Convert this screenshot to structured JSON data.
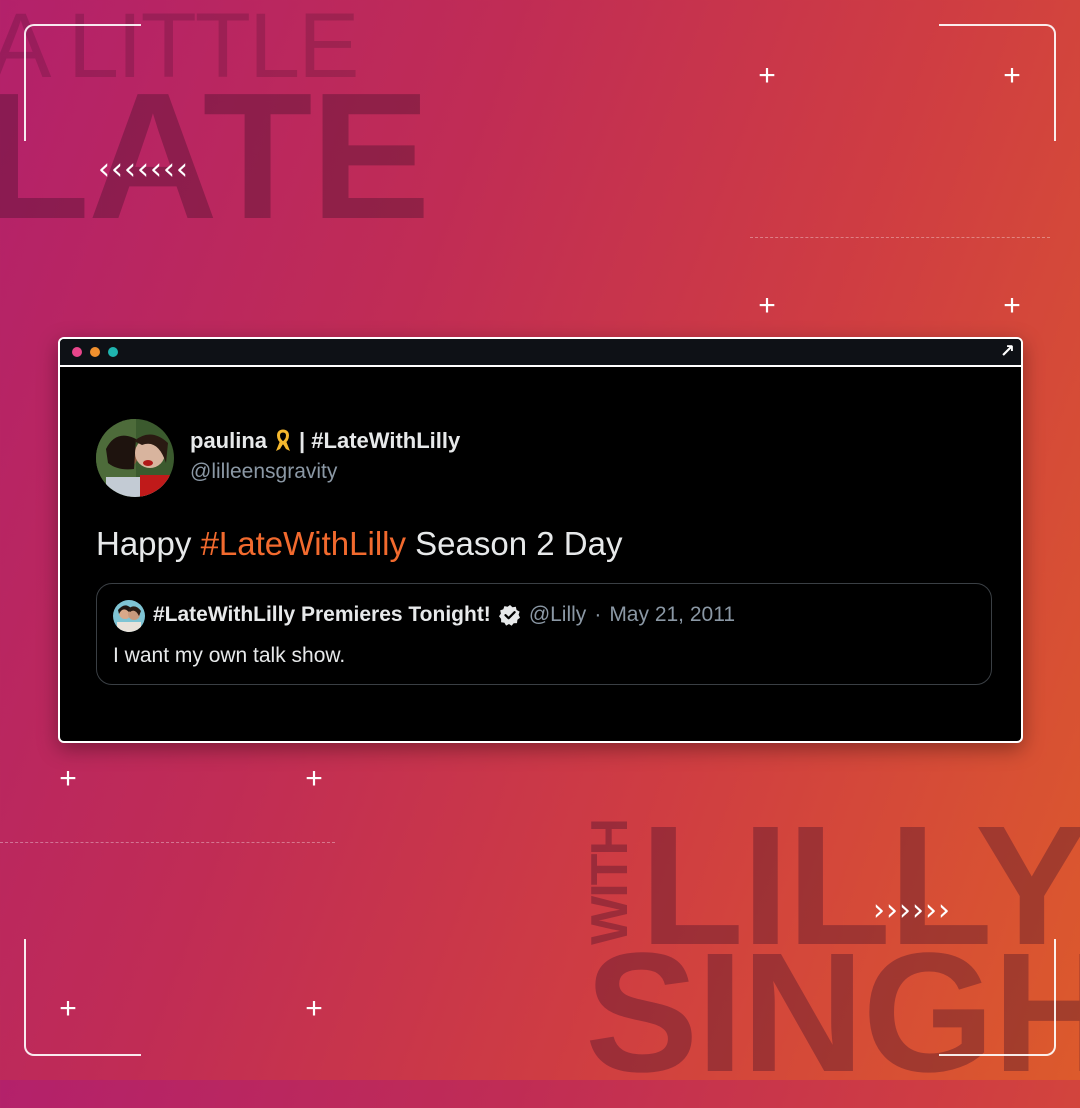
{
  "background": {
    "top_left_text_1": "A LITTLE",
    "top_left_text_2": "LATE",
    "bottom_right_text_with": "WITH",
    "bottom_right_text_lilly": "LILLY",
    "bottom_right_text_singh": "SINGH",
    "chevrons_left": "‹‹‹‹‹‹‹",
    "chevrons_right": "››››››",
    "gradient_colors": [
      "#b3216b",
      "#c02c55",
      "#cf3d42",
      "#dc5a2c"
    ]
  },
  "window": {
    "dots": [
      "#e8458b",
      "#f0902e",
      "#1fb5b0"
    ],
    "expand_icon": "↗"
  },
  "tweet": {
    "display_name": "paulina",
    "display_name_suffix": "| #LateWithLilly",
    "handle": "@lilleensgravity",
    "text_before": "Happy ",
    "hashtag": "#LateWithLilly",
    "text_after": " Season 2 Day",
    "hashtag_color": "#f26a2e",
    "quoted": {
      "display_name": "#LateWithLilly Premieres Tonight!",
      "handle": "@Lilly",
      "separator": "·",
      "date": "May 21, 2011",
      "text": "I want my own talk show."
    }
  }
}
